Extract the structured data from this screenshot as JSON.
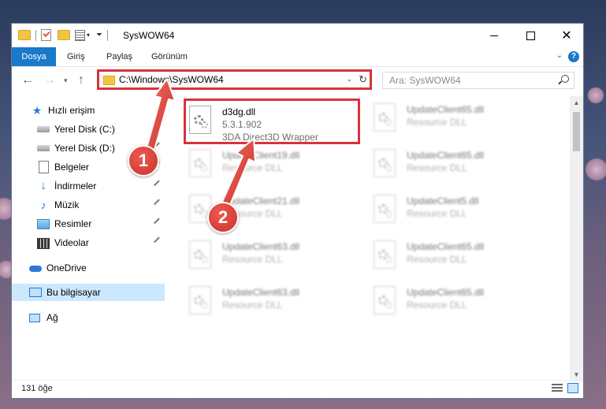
{
  "window": {
    "title": "SysWOW64"
  },
  "ribbon": {
    "tabs": [
      "Dosya",
      "Giriş",
      "Paylaş",
      "Görünüm"
    ]
  },
  "address": {
    "path": "C:\\Windows\\SysWOW64"
  },
  "search": {
    "placeholder": "Ara: SysWOW64"
  },
  "sidebar": {
    "items": [
      {
        "label": "Hızlı erişim",
        "icon": "star-icon"
      },
      {
        "label": "Yerel Disk (C:)",
        "icon": "drive-icon",
        "pinned": true
      },
      {
        "label": "Yerel Disk (D:)",
        "icon": "drive-icon",
        "pinned": true
      },
      {
        "label": "Belgeler",
        "icon": "documents-icon",
        "pinned": true
      },
      {
        "label": "İndirmeler",
        "icon": "download-icon",
        "pinned": true
      },
      {
        "label": "Müzik",
        "icon": "music-icon",
        "pinned": true
      },
      {
        "label": "Resimler",
        "icon": "pictures-icon",
        "pinned": true
      },
      {
        "label": "Videolar",
        "icon": "videos-icon",
        "pinned": true
      },
      {
        "label": "OneDrive",
        "icon": "cloud-icon"
      },
      {
        "label": "Bu bilgisayar",
        "icon": "computer-icon",
        "selected": true
      },
      {
        "label": "Ağ",
        "icon": "network-icon"
      }
    ]
  },
  "files": [
    {
      "name": "d3dg.dll",
      "line2": "5.3.1.902",
      "line3": "3DA Direct3D Wrapper",
      "highlighted": true
    },
    {
      "name": "UpdateClient65.dll",
      "line2": "Resource DLL"
    },
    {
      "name": "UpdateClient19.dll",
      "line2": "Resource DLL"
    },
    {
      "name": "UpdateClient65.dll",
      "line2": "Resource DLL"
    },
    {
      "name": "UpdateClient21.dll",
      "line2": "Resource DLL"
    },
    {
      "name": "UpdateClient5.dll",
      "line2": "Resource DLL"
    },
    {
      "name": "UpdateClient63.dll",
      "line2": "Resource DLL"
    },
    {
      "name": "UpdateClient65.dll",
      "line2": "Resource DLL"
    },
    {
      "name": "UpdateClient63.dll",
      "line2": "Resource DLL"
    },
    {
      "name": "UpdateClient65.dll",
      "line2": "Resource DLL"
    }
  ],
  "status": {
    "count": "131 öğe"
  },
  "callouts": {
    "one": "1",
    "two": "2"
  },
  "colors": {
    "accent": "#1979ca",
    "highlight": "#d9323b",
    "selection": "#cce8ff"
  }
}
